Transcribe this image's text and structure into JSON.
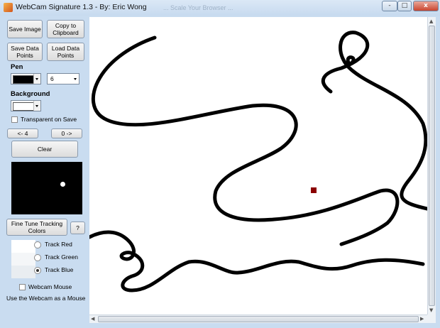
{
  "window": {
    "title": "WebCam Signature 1.3 - By: Eric Wong",
    "ghost_text": "... Scale Your Browser ...",
    "minimize": "-",
    "maximize": "□",
    "close": "x"
  },
  "buttons": {
    "save_image": "Save Image",
    "copy_clipboard": "Copy to Clipboard",
    "save_points": "Save Data Points",
    "load_points": "Load Data Points",
    "prev": "<- 4",
    "next": "0 ->",
    "clear": "Clear",
    "fine_tune": "Fine Tune Tracking Colors",
    "help": "?"
  },
  "pen": {
    "label": "Pen",
    "color": "#000000",
    "size": "6"
  },
  "background": {
    "label": "Background",
    "color": "#ffffff",
    "transparent_label": "Transparent on Save",
    "transparent_checked": false
  },
  "tracking": {
    "red_label": "Track Red",
    "green_label": "Track Green",
    "blue_label": "Track Blue",
    "selected": "blue"
  },
  "webcam_mouse": {
    "label": "Webcam Mouse",
    "hint": "Use the Webcam as a Mouse",
    "checked": false
  },
  "colors": {
    "marker": "#8b0000",
    "stroke": "#000000"
  }
}
